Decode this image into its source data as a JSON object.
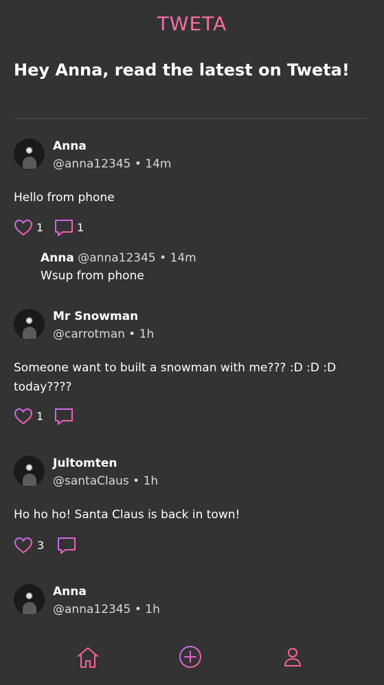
{
  "app": {
    "logo": "TWETA"
  },
  "header": {
    "greeting": "Hey Anna, read the latest on Tweta!"
  },
  "colors": {
    "background": "#333333",
    "accent_pink": "#ff5fa0",
    "accent_purple": "#c06cff"
  },
  "posts": [
    {
      "author": "Anna",
      "meta": "@anna12345 • 14m",
      "text": "Hello from phone",
      "likes": "1",
      "comments": "1",
      "reply": {
        "author": "Anna",
        "meta": "@anna12345 • 14m",
        "text": "Wsup from phone"
      }
    },
    {
      "author": "Mr Snowman",
      "meta": "@carrotman • 1h",
      "text": "Someone want to built a snowman with me??? :D :D :D today????",
      "likes": "1",
      "comments": ""
    },
    {
      "author": "Jultomten",
      "meta": "@santaClaus • 1h",
      "text": "Ho ho ho! Santa Claus is back in town!",
      "likes": "3",
      "comments": ""
    },
    {
      "author": "Anna",
      "meta": "@anna12345 • 1h"
    }
  ],
  "nav": {
    "items": [
      "home-icon",
      "add-circle-icon",
      "profile-icon"
    ]
  }
}
